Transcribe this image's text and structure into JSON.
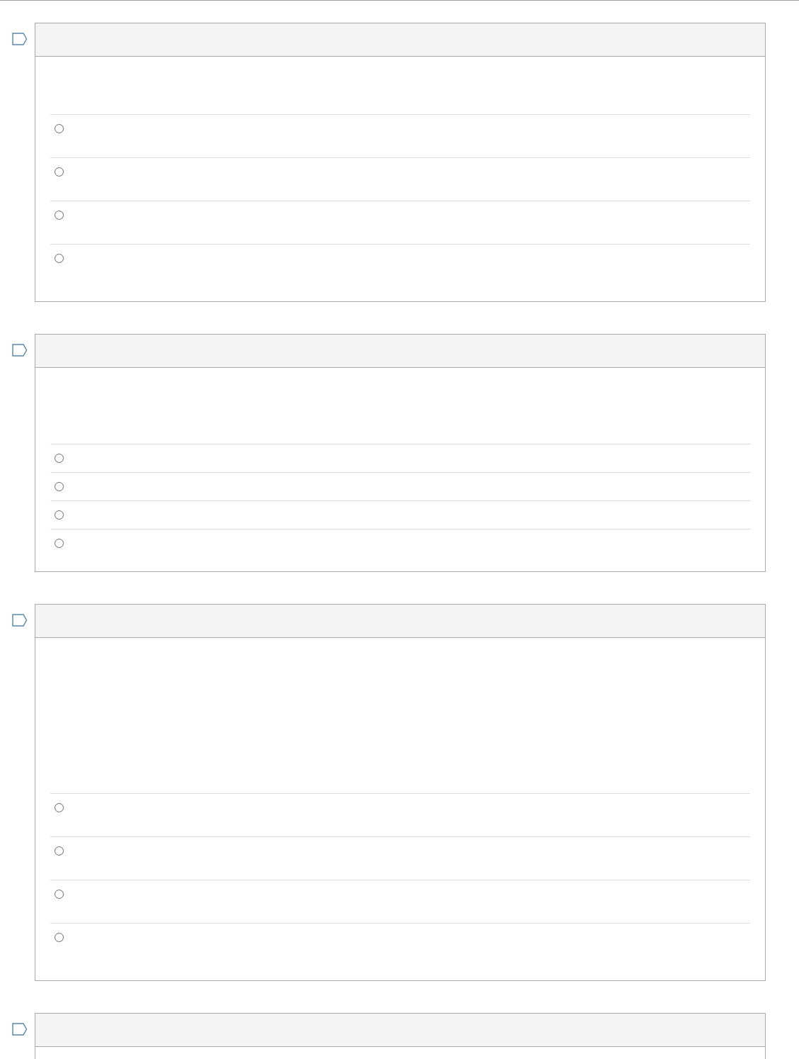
{
  "questions": [
    {
      "flagged": false,
      "options": [
        {
          "selected": false
        },
        {
          "selected": false
        },
        {
          "selected": false
        },
        {
          "selected": false
        }
      ]
    },
    {
      "flagged": false,
      "options": [
        {
          "selected": false
        },
        {
          "selected": false
        },
        {
          "selected": false
        },
        {
          "selected": false
        }
      ]
    },
    {
      "flagged": false,
      "options": [
        {
          "selected": false
        },
        {
          "selected": false
        },
        {
          "selected": false
        },
        {
          "selected": false
        }
      ]
    },
    {
      "flagged": false
    }
  ]
}
